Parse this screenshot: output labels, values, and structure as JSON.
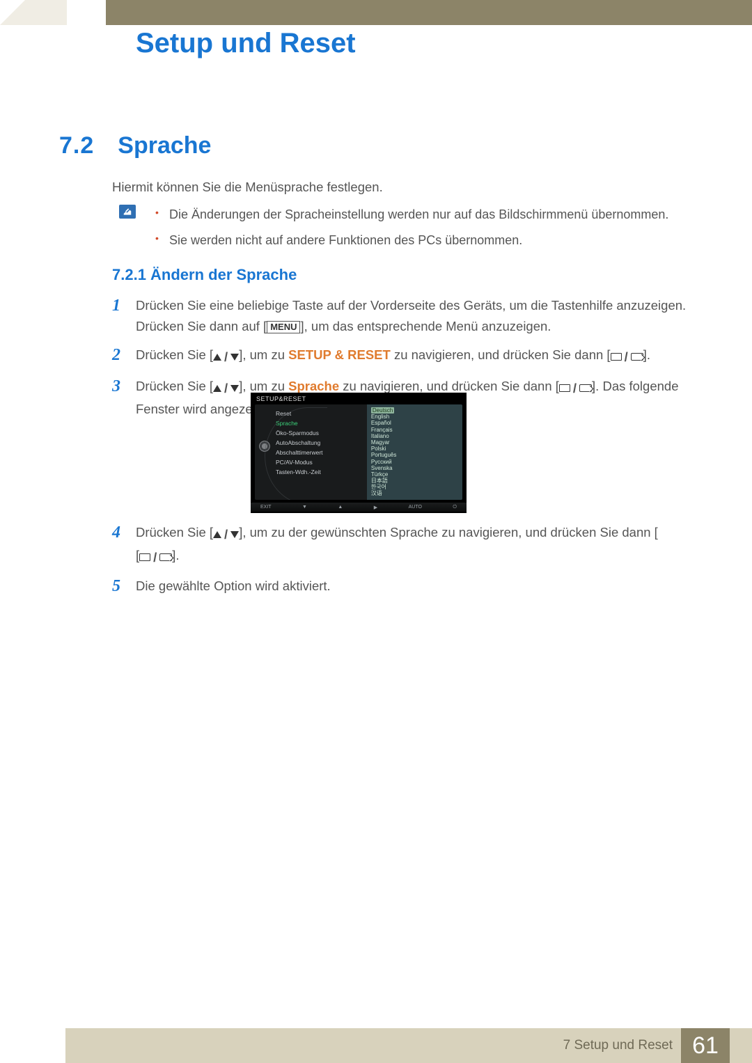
{
  "chapter_title": "Setup und Reset",
  "section": {
    "num": "7.2",
    "title": "Sprache"
  },
  "intro": "Hiermit können Sie die Menüsprache festlegen.",
  "notes": [
    "Die Änderungen der Spracheinstellung werden nur auf das Bildschirmmenü übernommen.",
    "Sie werden nicht auf andere Funktionen des PCs übernommen."
  ],
  "subsection": "7.2.1  Ändern der Sprache",
  "steps": {
    "s1a": "Drücken Sie eine beliebige Taste auf der Vorderseite des Geräts, um die Tastenhilfe anzuzeigen. Drücken Sie dann auf [",
    "s1b": "], um das entsprechende Menü anzuzeigen.",
    "menu_label": "MENU",
    "s2a": "Drücken Sie [",
    "s2b": "], um zu ",
    "s2kw": "SETUP & RESET",
    "s2c": " zu navigieren, und drücken Sie dann [",
    "s2d": "].",
    "s3a": "Drücken Sie [",
    "s3b": "], um zu ",
    "s3kw": "Sprache",
    "s3c": " zu navigieren, und drücken Sie dann [",
    "s3d": "]. Das folgende Fenster wird angezeigt.",
    "s4a": "Drücken Sie [",
    "s4b": "], um zu der gewünschten Sprache zu navigieren, und drücken Sie dann [",
    "s4c": "].",
    "s5": "Die gewählte Option wird aktiviert."
  },
  "osd": {
    "title": "SETUP&RESET",
    "menu": [
      "Reset",
      "Sprache",
      "Öko-Sparmodus",
      "AutoAbschaltung",
      "Abschalttimerwert",
      "PC/AV-Modus",
      "Tasten-Wdh.-Zeit"
    ],
    "menu_highlight_index": 1,
    "langs": [
      "Deutsch",
      "English",
      "Español",
      "Français",
      "Italiano",
      "Magyar",
      "Polski",
      "Português",
      "Русский",
      "Svenska",
      "Türkçe",
      "日本語",
      "한국어",
      "汉语"
    ],
    "lang_selected_index": 0,
    "footer": {
      "exit": "EXIT",
      "auto": "AUTO"
    }
  },
  "footer": {
    "chapter_ref": "7 Setup und Reset",
    "page_num": "61"
  }
}
